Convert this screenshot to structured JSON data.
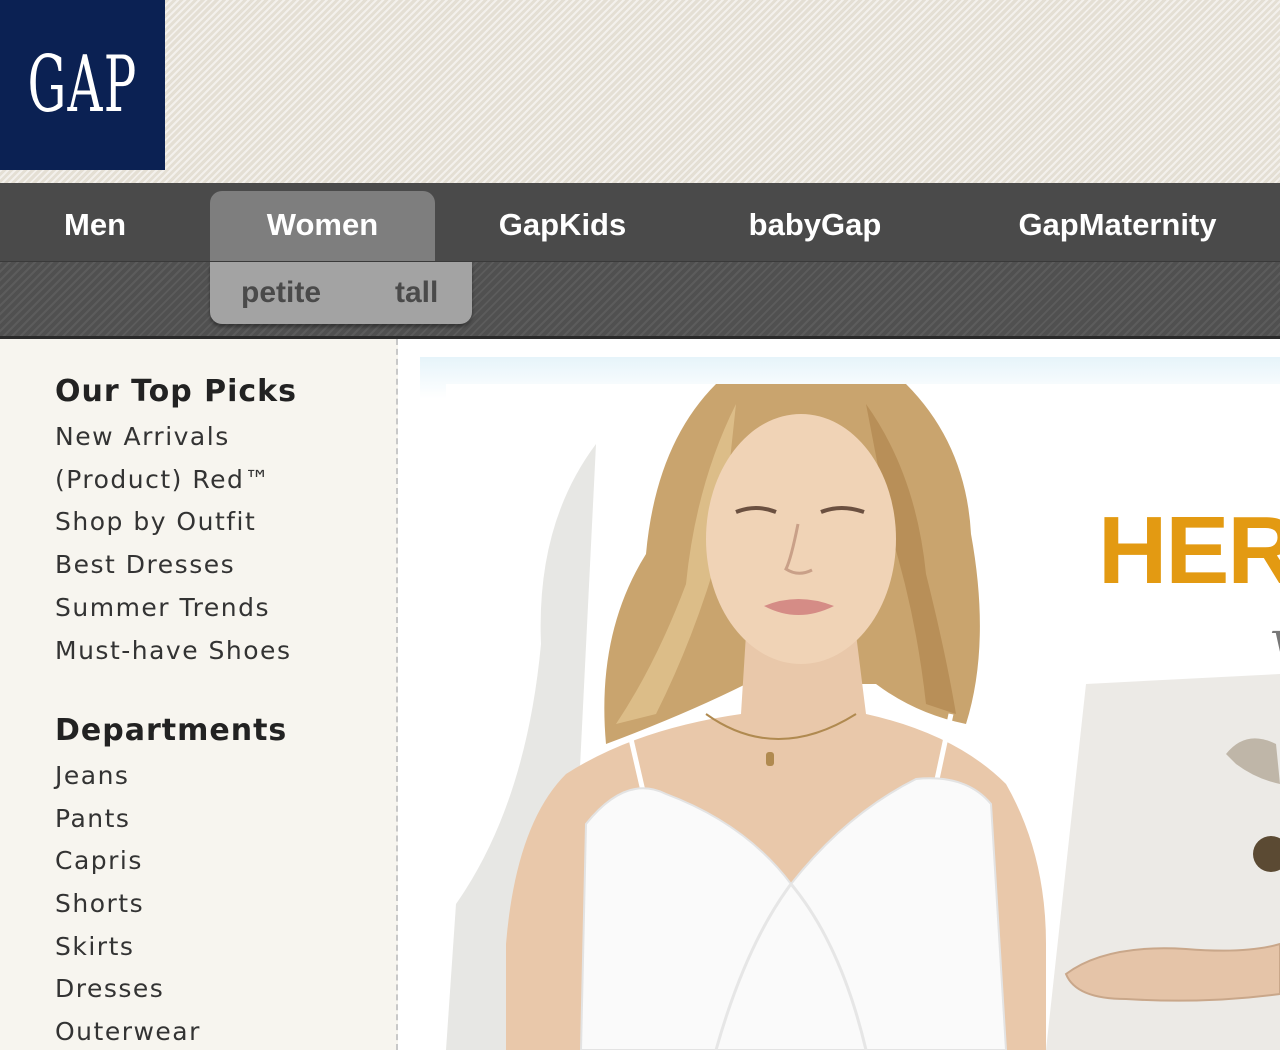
{
  "header": {
    "logo_text": "GAP"
  },
  "nav": {
    "items": [
      {
        "label": "Men",
        "active": false
      },
      {
        "label": "Women",
        "active": true
      },
      {
        "label": "GapKids",
        "active": false
      },
      {
        "label": "babyGap",
        "active": false
      },
      {
        "label": "GapMaternity",
        "active": false
      }
    ],
    "subnav": [
      {
        "label": "petite"
      },
      {
        "label": "tall"
      }
    ]
  },
  "sidebar": {
    "top_picks": {
      "title": "Our Top Picks",
      "links": [
        "New Arrivals",
        "(Product) Red™",
        "Shop by Outfit",
        "Best Dresses",
        "Summer Trends",
        "Must-have Shoes"
      ]
    },
    "departments": {
      "title": "Departments",
      "links": [
        "Jeans",
        "Pants",
        "Capris",
        "Shorts",
        "Skirts",
        "Dresses",
        "Outerwear"
      ]
    }
  },
  "hero": {
    "headline": "HERE",
    "script_text": "w",
    "colors": {
      "headline": "#e39a12",
      "band": "#e6f4fa"
    }
  },
  "colors": {
    "logo_bg": "#0b2153",
    "nav_bg": "#4a4a4a",
    "nav_active": "#7e7e7e",
    "subnav_box": "#a3a3a3",
    "sidebar_bg": "#f7f5ef"
  }
}
